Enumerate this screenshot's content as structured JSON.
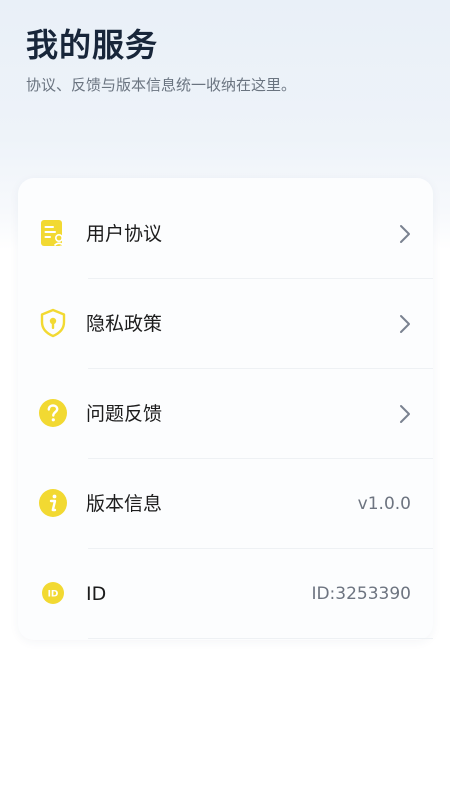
{
  "header": {
    "title": "我的服务",
    "subtitle": "协议、反馈与版本信息统一收纳在这里。"
  },
  "menu": [
    {
      "label": "用户协议",
      "icon": "document-icon"
    },
    {
      "label": "隐私政策",
      "icon": "shield-icon"
    },
    {
      "label": "问题反馈",
      "icon": "question-icon"
    },
    {
      "label": "版本信息",
      "icon": "info-icon",
      "value": "v1.0.0"
    },
    {
      "label": "ID",
      "icon": "id-icon",
      "value": "ID:3253390"
    }
  ],
  "colors": {
    "accent": "#f2d932",
    "chevron": "#7a8290"
  }
}
